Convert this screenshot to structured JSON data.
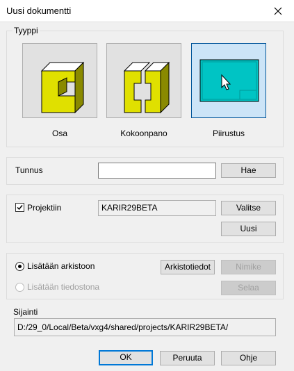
{
  "window": {
    "title": "Uusi dokumentti",
    "close_icon": "close-icon"
  },
  "type_group": {
    "title": "Tyyppi",
    "items": [
      {
        "label": "Osa",
        "icon": "part-icon",
        "selected": false
      },
      {
        "label": "Kokoonpano",
        "icon": "assembly-icon",
        "selected": false
      },
      {
        "label": "Piirustus",
        "icon": "drawing-icon",
        "selected": true
      }
    ]
  },
  "id_group": {
    "label": "Tunnus",
    "input_value": "",
    "search_button": "Hae"
  },
  "project_group": {
    "checkbox_label": "Projektiin",
    "checked": true,
    "project_value": "KARIR29BETA",
    "select_button": "Valitse",
    "new_button": "Uusi"
  },
  "storage_group": {
    "archive_radio_label": "Lisätään arkistoon",
    "file_radio_label": "Lisätään tiedostona",
    "selected": "archive",
    "archive_info_button": "Arkistotiedot",
    "name_button": "Nimike",
    "browse_button": "Selaa"
  },
  "location_group": {
    "title": "Sijainti",
    "path": "D:/29_0/Local/Beta/vxg4/shared/projects/KARIR29BETA/"
  },
  "footer": {
    "ok": "OK",
    "cancel": "Peruuta",
    "help": "Ohje"
  },
  "colors": {
    "icon_yellow": "#e0e000",
    "drawing_teal": "#00c4c4",
    "selection_blue": "#cce4f7",
    "selection_border": "#005499",
    "default_button_border": "#0078d7"
  }
}
